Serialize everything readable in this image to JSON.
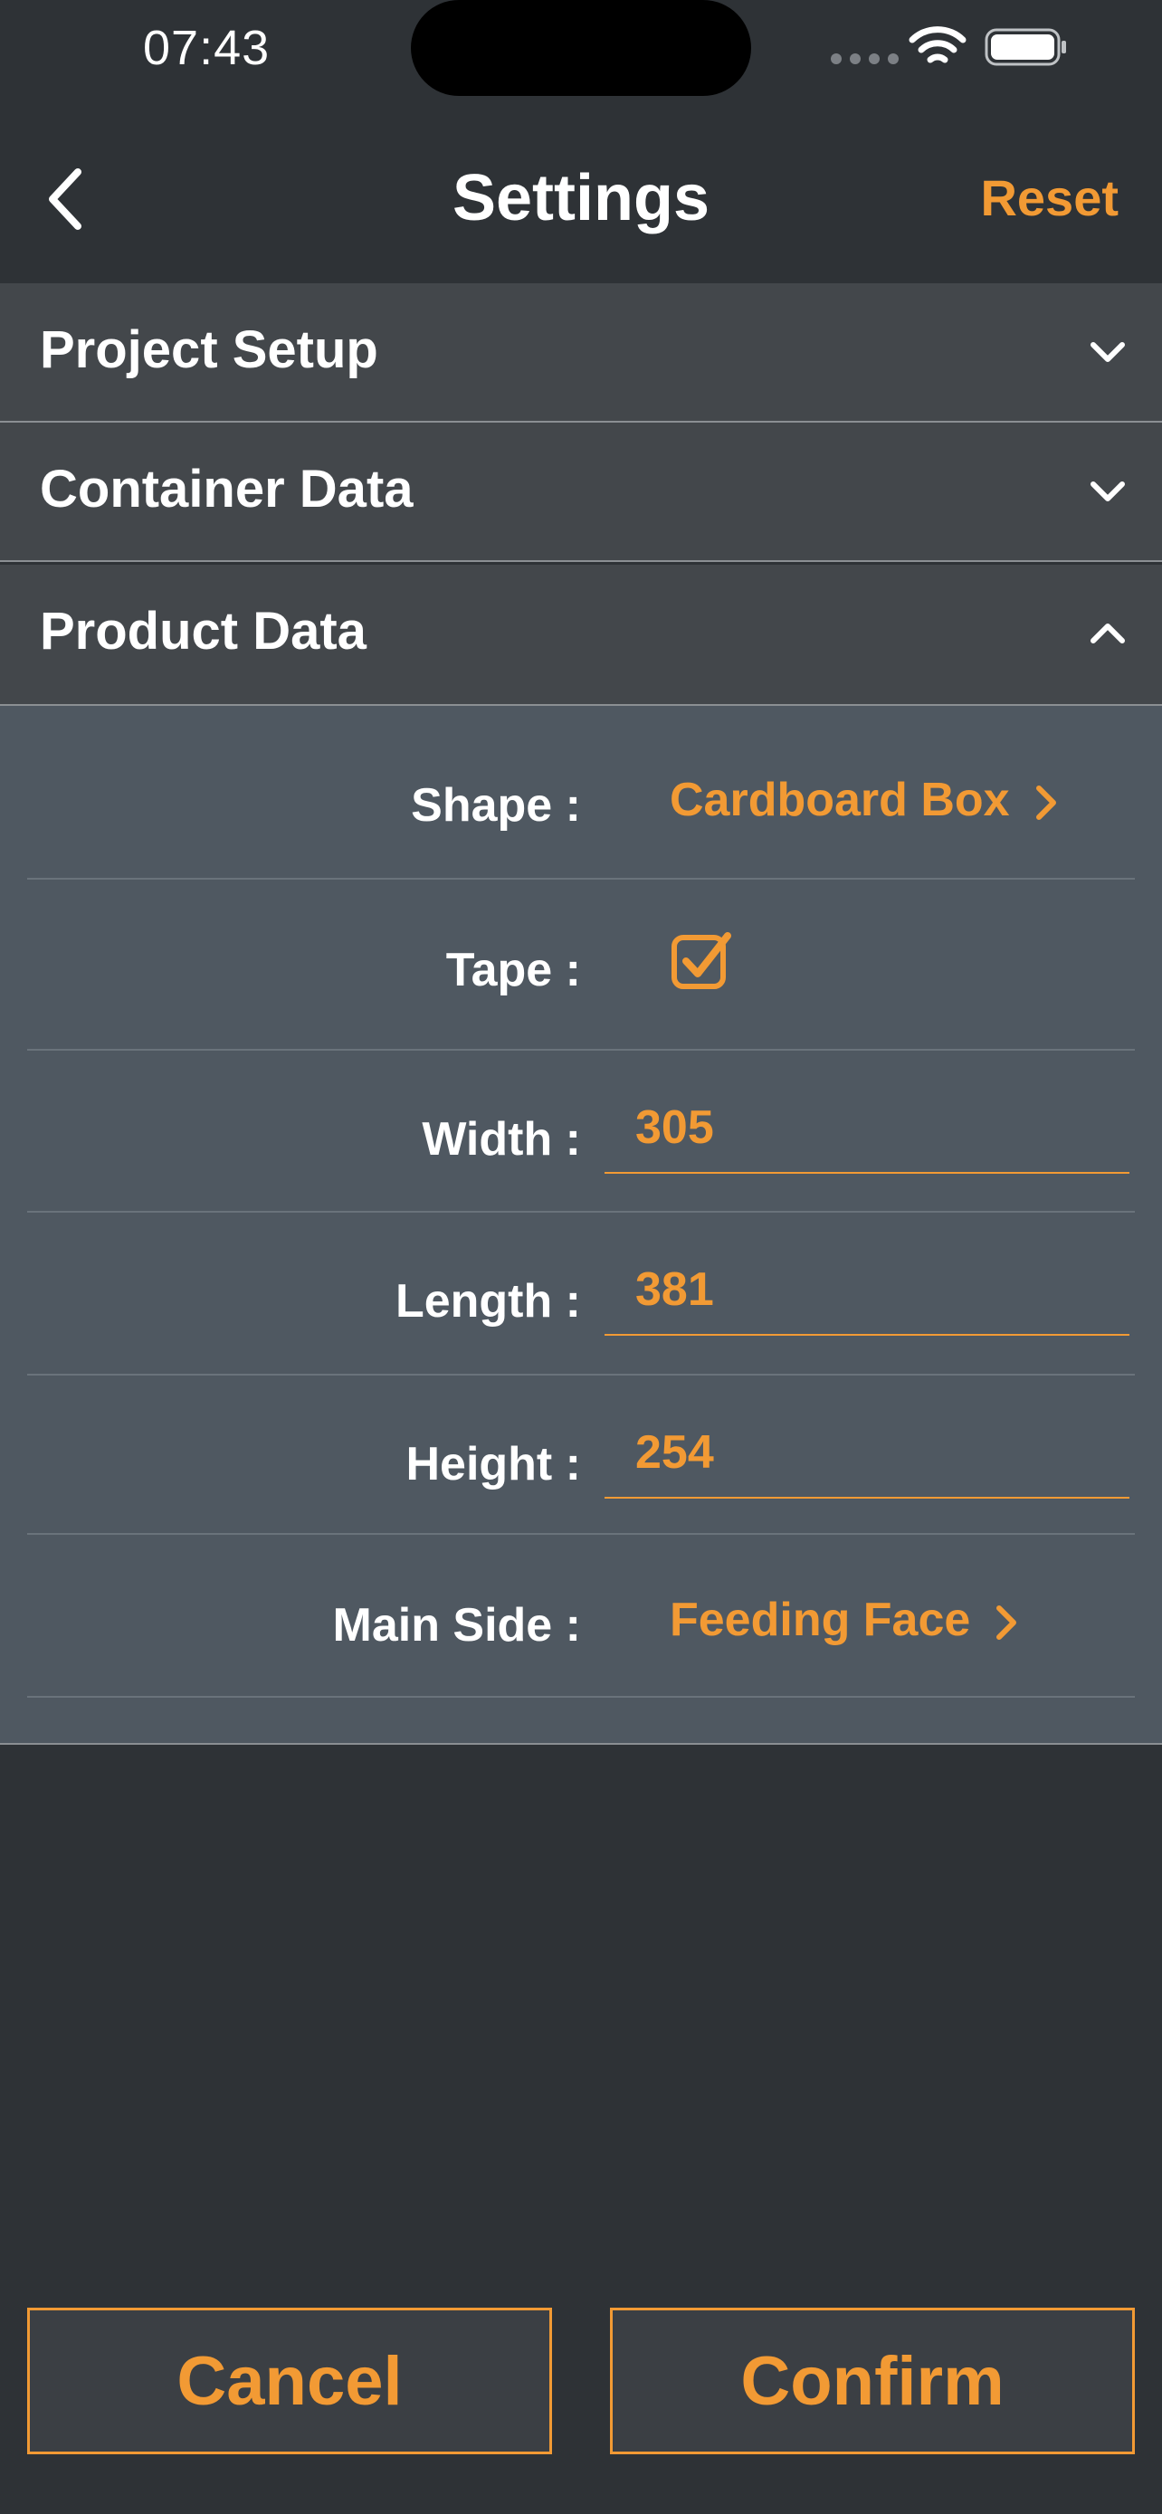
{
  "status_bar": {
    "time": "07:43"
  },
  "nav": {
    "title": "Settings",
    "reset_label": "Reset"
  },
  "sections": {
    "project_setup": "Project Setup",
    "container_data": "Container Data",
    "product_data": "Product Data"
  },
  "product": {
    "shape_label": "Shape :",
    "shape_value": "Cardboard Box",
    "tape_label": "Tape :",
    "tape_checked": true,
    "width_label": "Width :",
    "width_value": "305",
    "length_label": "Length :",
    "length_value": "381",
    "height_label": "Height :",
    "height_value": "254",
    "main_side_label": "Main Side :",
    "main_side_value": "Feeding Face"
  },
  "footer": {
    "cancel_label": "Cancel",
    "confirm_label": "Confirm"
  },
  "colors": {
    "accent": "#f29a34",
    "background": "#2e3236",
    "header": "#43474b",
    "panel": "#4f5861"
  },
  "icons": [
    "back-chevron-icon",
    "chevron-down-icon",
    "chevron-up-icon",
    "chevron-right-icon",
    "checkbox-checked-icon",
    "wifi-icon",
    "battery-icon",
    "signal-icon"
  ]
}
